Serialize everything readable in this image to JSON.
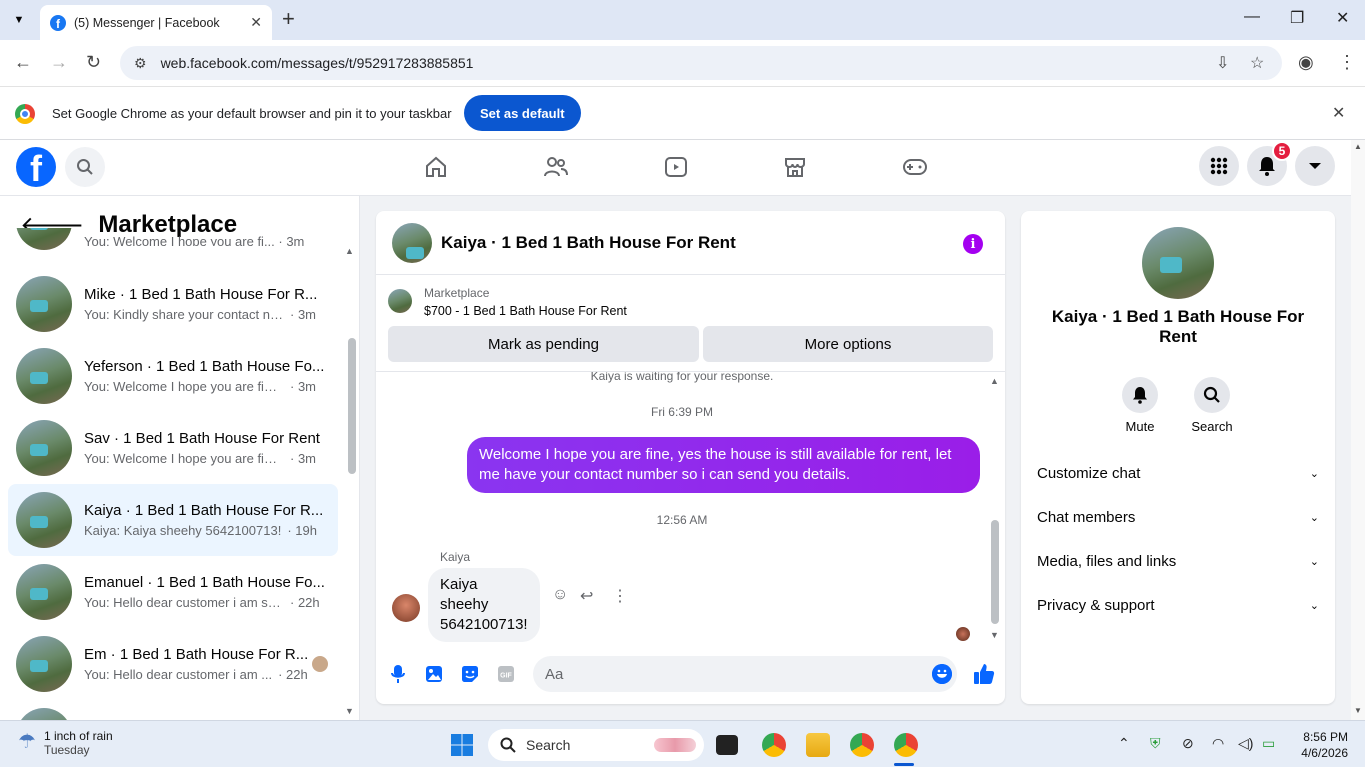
{
  "browser": {
    "tab_title": "(5) Messenger | Facebook",
    "url": "web.facebook.com/messages/t/952917283885851",
    "infobar_text": "Set Google Chrome as your default browser and pin it to your taskbar",
    "set_default_label": "Set as default"
  },
  "facebook": {
    "logo": "f",
    "notification_count": "5"
  },
  "sidebar": {
    "title": "Marketplace",
    "partial_top_preview": "You: Welcome I hope you are fi... · 3m",
    "conversations": [
      {
        "name": "Mike · 1 Bed 1 Bath House For R...",
        "preview": "You: Kindly share your contact nu...",
        "time": "· 3m"
      },
      {
        "name": "Yeferson · 1 Bed 1 Bath House Fo...",
        "preview": "You: Welcome I hope you are fine, ...",
        "time": "· 3m"
      },
      {
        "name": "Sav · 1 Bed 1 Bath House For Rent",
        "preview": "You: Welcome I hope you are fine, ...",
        "time": "· 3m"
      },
      {
        "name": "Kaiya · 1 Bed 1 Bath House For R...",
        "preview": "Kaiya: Kaiya sheehy 5642100713!",
        "time": "· 19h"
      },
      {
        "name": "Emanuel · 1 Bed 1 Bath House Fo...",
        "preview": "You: Hello dear customer i am still...",
        "time": "· 22h"
      },
      {
        "name": "Em · 1 Bed 1 Bath House For R...",
        "preview": "You: Hello dear customer i am ...",
        "time": "· 22h"
      }
    ]
  },
  "chat": {
    "title": "Kaiya · 1 Bed 1 Bath House For Rent",
    "listing_source": "Marketplace",
    "listing_title": "$700 - 1 Bed 1 Bath House For Rent",
    "mark_pending_label": "Mark as pending",
    "more_options_label": "More options",
    "waiting_text": "Kaiya is waiting for your response.",
    "timestamp1": "Fri 6:39 PM",
    "outgoing_message": "Welcome I hope you are fine, yes the house is still available for rent, let me have your contact number so i can send you  details.",
    "timestamp2": "12:56 AM",
    "sender_name": "Kaiya",
    "incoming_message": "Kaiya sheehy 5642100713!",
    "input_placeholder": "Aa"
  },
  "details": {
    "name": "Kaiya · 1 Bed 1 Bath House For Rent",
    "mute_label": "Mute",
    "search_label": "Search",
    "sections": [
      "Customize chat",
      "Chat members",
      "Media, files and links",
      "Privacy & support"
    ]
  },
  "taskbar": {
    "weather_line1": "1 inch of rain",
    "weather_line2": "Tuesday",
    "search_label": "Search",
    "time": "8:56 PM",
    "date": "4/6/2026"
  },
  "colors": {
    "messenger_purple": "#a400f0",
    "fb_blue": "#0866ff",
    "chrome_blue": "#0b57d0",
    "badge_red": "#e41e3f"
  }
}
